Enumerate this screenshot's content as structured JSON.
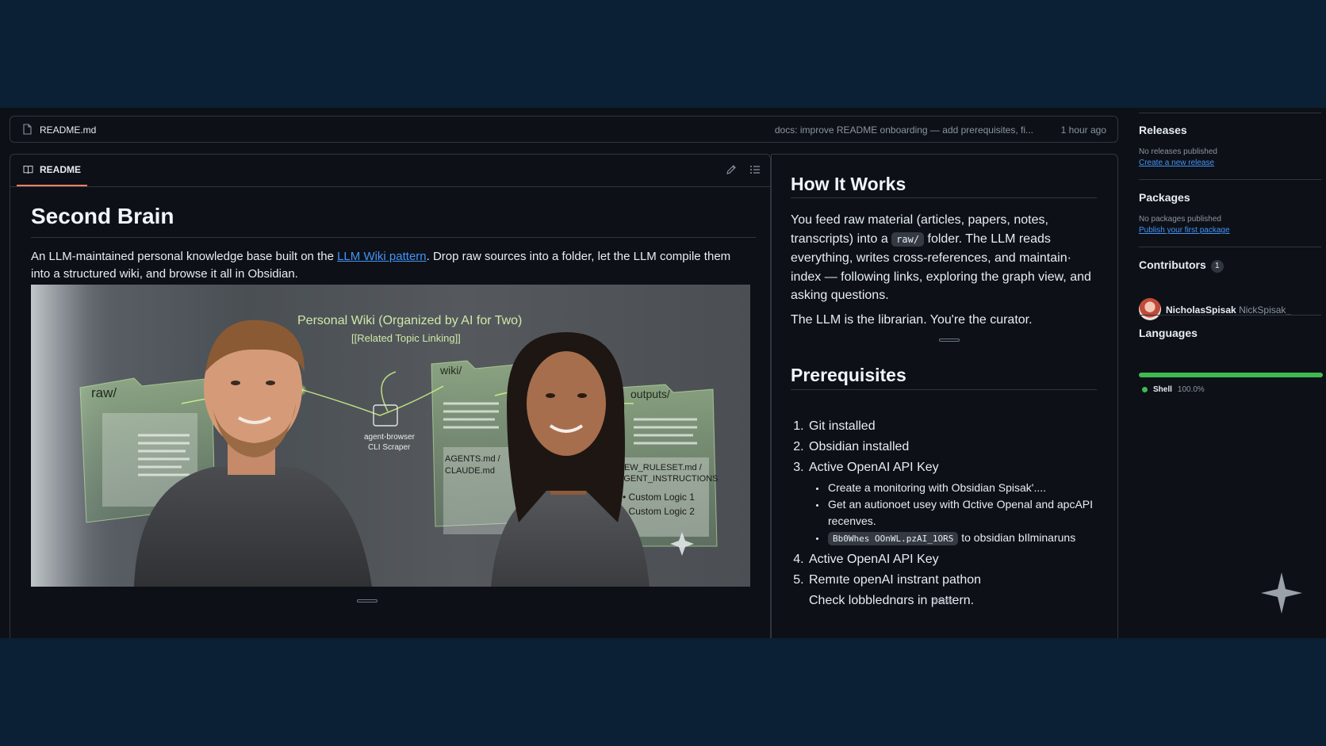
{
  "file_bar": {
    "filename": "README.md",
    "commit_message": "docs: improve README onboarding — add prerequisites, fi...",
    "time_ago": "1 hour ago"
  },
  "readme_tab": {
    "label": "README"
  },
  "readme": {
    "title": "Second Brain",
    "desc_before": "An LLM-maintained personal knowledge base built on the ",
    "desc_link": "LLM Wiki pattern",
    "desc_after": ". Drop raw sources into a folder, let the LLM compile them into a structured wiki, and browse it all in Obsidian."
  },
  "hero_image": {
    "title_line1": "Personal Wiki (Organized by AI for Two)",
    "title_line2": "[[Related Topic Linking]]",
    "folder_raw": "raw/",
    "folder_wiki": "wiki/",
    "folder_outputs": "outputs/",
    "scraper_line1": "agent-browser",
    "scraper_line2": "CLI Scraper",
    "agents_line1": "AGENTS.md /",
    "agents_line2": "CLAUDE.md",
    "ruleset_line1": "NEW_RULESET.md /",
    "ruleset_line2": "AGENT_INSTRUCTIONS",
    "custom1": "• Custom Logic 1",
    "custom2": "• Custom Logic 2"
  },
  "how_it_works": {
    "heading": "How It Works",
    "p1_before": "You feed raw material (articles, papers, notes, transcripts) into a ",
    "p1_code": "raw/",
    "p1_after": " folder. The LLM reads everything, writes cross-references, and maintain· index — following links, exploring the graph view, and asking questions.",
    "p2": "The LLM is the librarian. You're the curator."
  },
  "prerequisites": {
    "heading": "Prerequisites",
    "item1": "Git installed",
    "item2": "Obsidian installed",
    "item3": "Active OpenAI API Key",
    "sub1": "Create a monitoring with Obsidian Spisak'....",
    "sub2": "Get an autionoet usey with Ɑctive Openal and apcAPI recenves.",
    "sub3_code": "Bb0Whes OOnWL.pzAI_1ORS",
    "sub3_text": " to obsidian bIlminaruns",
    "item4": "Active OpenAI API Key",
    "item5_line1": "Remıte openAI instrant pathon",
    "item5_line2": "Check lobblednɑrs in pattern."
  },
  "sidebar": {
    "releases": {
      "heading": "Releases",
      "empty": "No releases published",
      "link": "Create a new release"
    },
    "packages": {
      "heading": "Packages",
      "empty": "No packages published",
      "link": "Publish your first package"
    },
    "contributors": {
      "heading": "Contributors",
      "count": "1",
      "name": "NicholasSpisak",
      "handle": "NickSpisak_"
    },
    "languages": {
      "heading": "Languages",
      "name": "Shell",
      "percent": "100.0%",
      "share": 1.0
    }
  },
  "colors": {
    "accent_link": "#4493f8",
    "tab_underline": "#f78166",
    "language_shell": "#3fb950",
    "outer_background": "#0b2034",
    "page_background": "#0d1117"
  }
}
